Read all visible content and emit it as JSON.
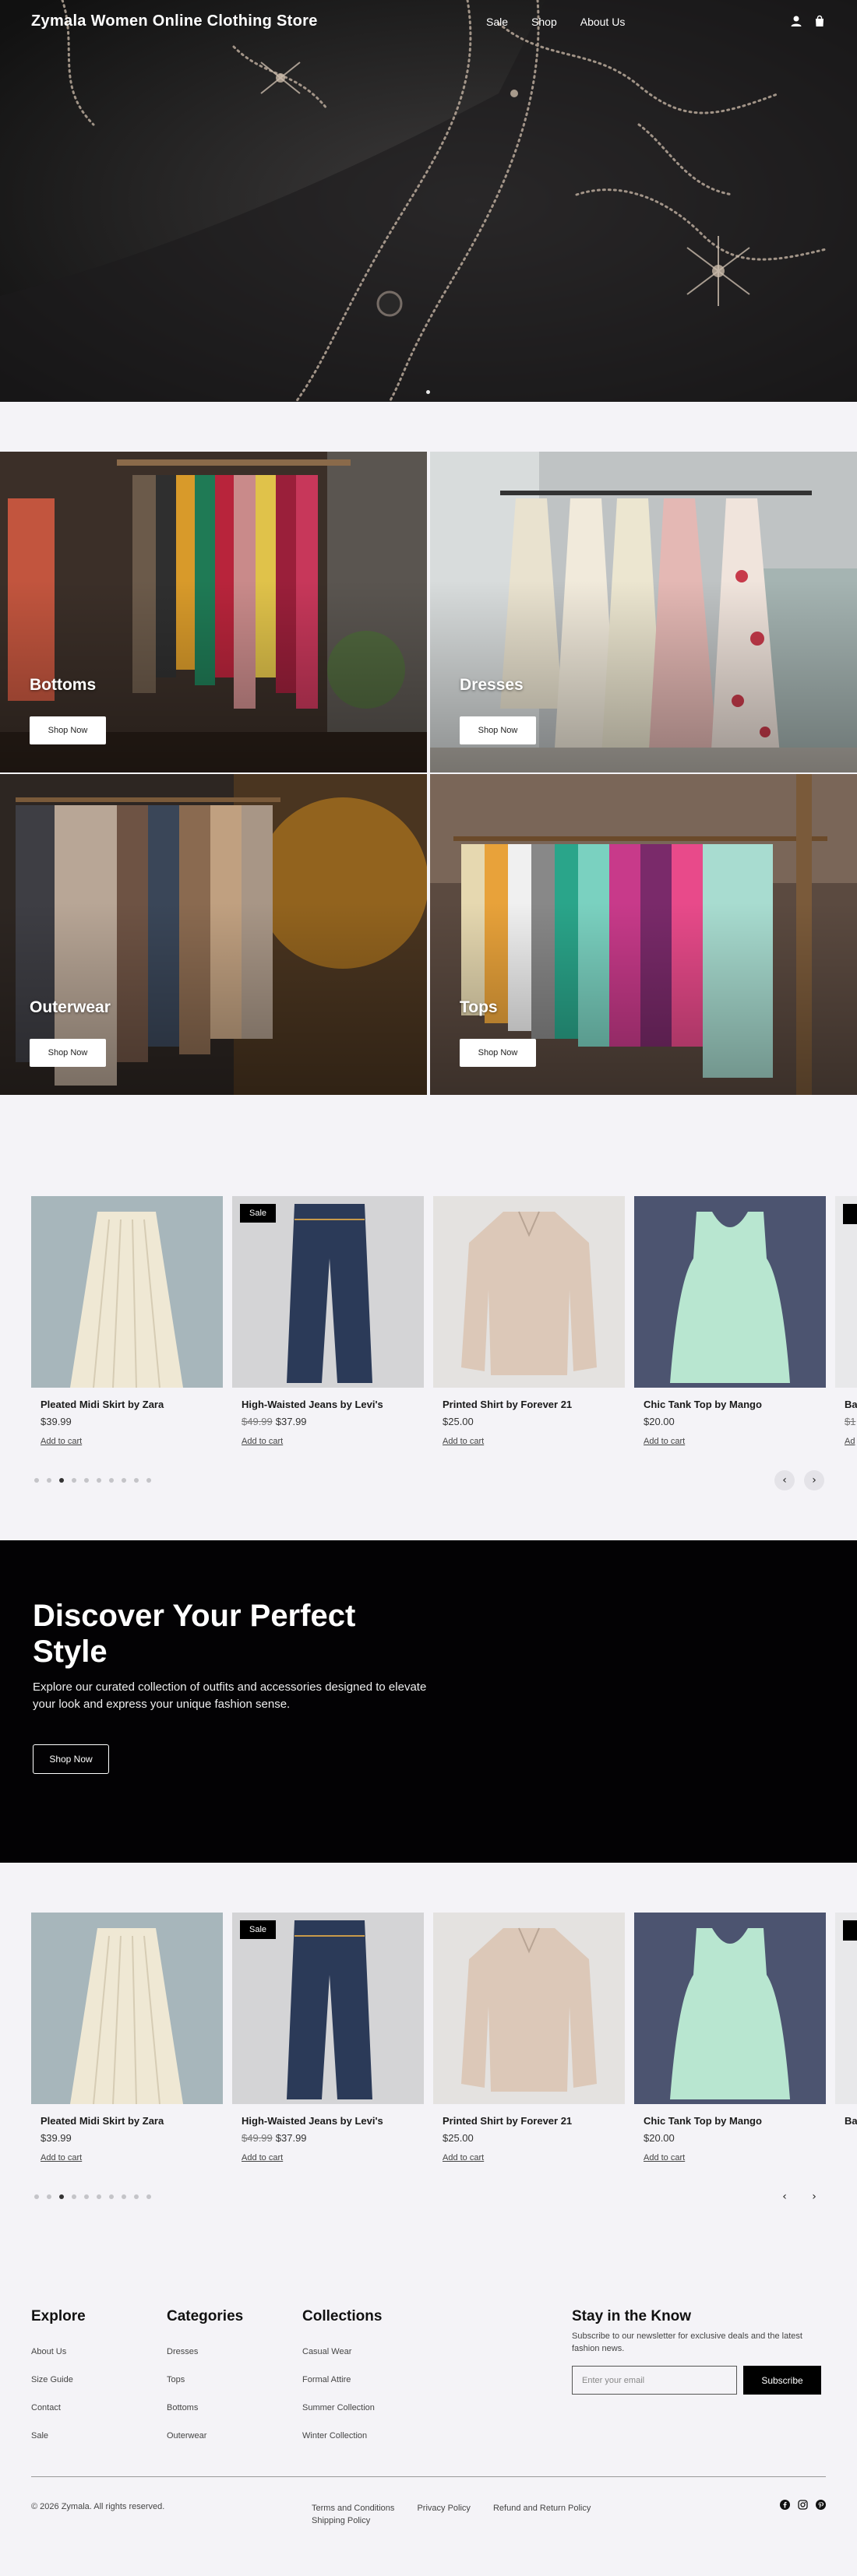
{
  "header": {
    "brand": "Zymala Women Online Clothing Store",
    "nav": [
      "Sale",
      "Shop",
      "About Us"
    ],
    "icons": [
      "user-icon",
      "shopping-bag-icon"
    ]
  },
  "categories": [
    {
      "title": "Bottoms",
      "button": "Shop Now"
    },
    {
      "title": "Dresses",
      "button": "Shop Now"
    },
    {
      "title": "Outerwear",
      "button": "Shop Now"
    },
    {
      "title": "Tops",
      "button": "Shop Now"
    }
  ],
  "products": [
    {
      "name": "Pleated Midi Skirt by Zara",
      "price": "$39.99",
      "old_price": "",
      "sale": false,
      "cart": "Add to cart"
    },
    {
      "name": "High-Waisted Jeans by Levi's",
      "price": "$37.99",
      "old_price": "$49.99",
      "sale": true,
      "badge": "Sale",
      "cart": "Add to cart"
    },
    {
      "name": "Printed Shirt by Forever 21",
      "price": "$25.00",
      "old_price": "",
      "sale": false,
      "cart": "Add to cart"
    },
    {
      "name": "Chic Tank Top by Mango",
      "price": "$20.00",
      "old_price": "",
      "sale": false,
      "cart": "Add to cart"
    },
    {
      "name": "Ba",
      "price": "",
      "old_price": "$1",
      "sale": true,
      "badge": "",
      "cart": "Ad"
    }
  ],
  "carousel": {
    "dot_count": 10,
    "active_dot": 3,
    "prev": "‹",
    "next": "›"
  },
  "promo": {
    "title": "Discover Your Perfect Style",
    "text": "Explore our curated collection of outfits and accessories designed to elevate your look and express your unique fashion sense.",
    "button": "Shop Now"
  },
  "footer": {
    "columns": [
      {
        "title": "Explore",
        "links": [
          "About Us",
          "Size Guide",
          "Contact",
          "Sale"
        ]
      },
      {
        "title": "Categories",
        "links": [
          "Dresses",
          "Tops",
          "Bottoms",
          "Outerwear"
        ]
      },
      {
        "title": "Collections",
        "links": [
          "Casual Wear",
          "Formal Attire",
          "Summer Collection",
          "Winter Collection"
        ]
      }
    ],
    "newsletter": {
      "title": "Stay in the Know",
      "text": "Subscribe to our newsletter for exclusive deals and the latest fashion news.",
      "placeholder": "Enter your email",
      "button": "Subscribe"
    },
    "copyright": "© 2026 Zymala. All rights reserved.",
    "legal": [
      "Terms and Conditions",
      "Privacy Policy",
      "Refund and Return Policy",
      "Shipping Policy"
    ],
    "social": [
      "facebook-icon",
      "instagram-icon",
      "pinterest-icon"
    ]
  },
  "colors": {
    "dark": "#030204",
    "page_bg": "#f4f3f7",
    "accent": "#000000"
  }
}
